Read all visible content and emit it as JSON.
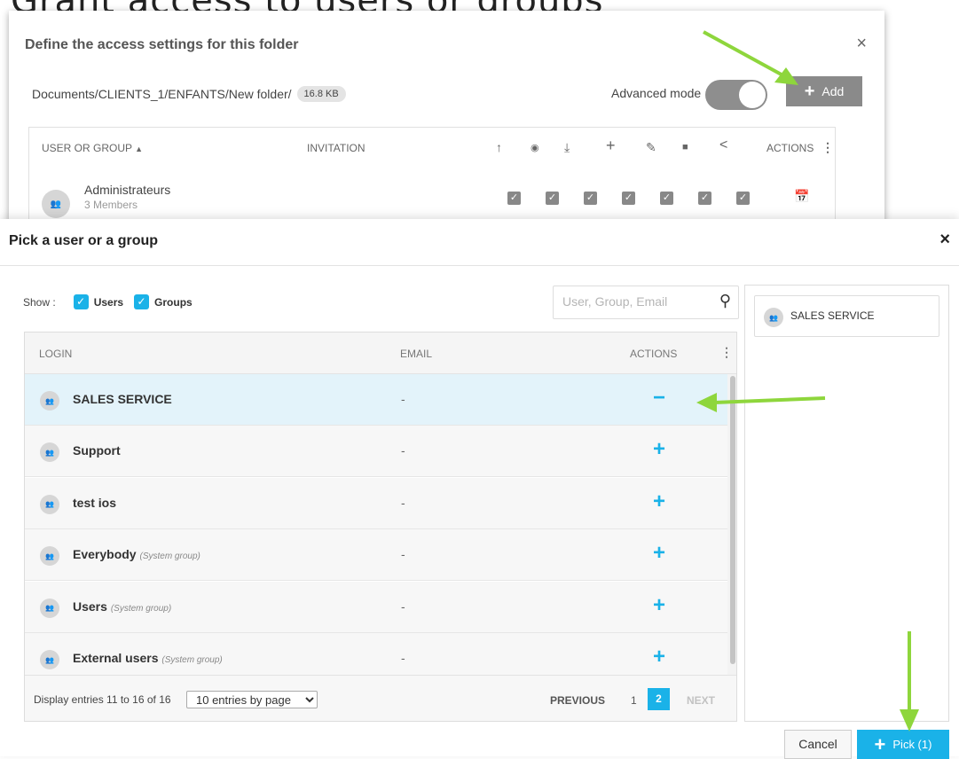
{
  "page_title": "Grant access to users or groups",
  "colors": {
    "accent": "#1ab2e8",
    "arrow": "#8ed63c",
    "selected_row": "#e3f3fa"
  },
  "background_dialog": {
    "title": "Define the access settings for this folder",
    "close_icon": "×",
    "path": "Documents/CLIENTS_1/ENFANTS/New folder/",
    "size": "16.8 KB",
    "advanced_mode_label": "Advanced mode",
    "advanced_mode_on": true,
    "add_label": "Add",
    "columns": {
      "user_or_group": "USER OR GROUP",
      "invitation": "INVITATION",
      "actions": "ACTIONS"
    },
    "permission_icons": [
      "upload-icon",
      "view-icon",
      "download-icon",
      "add-icon",
      "edit-icon",
      "delete-icon",
      "share-icon"
    ],
    "row": {
      "name": "Administrateurs",
      "members": "3 Members",
      "avatar": "group-icon",
      "action_icon": "calendar-icon"
    }
  },
  "picker": {
    "title": "Pick a user or a group",
    "close_icon": "×",
    "show_label": "Show :",
    "filters": [
      {
        "label": "Users",
        "checked": true
      },
      {
        "label": "Groups",
        "checked": true
      }
    ],
    "search_placeholder": "User, Group, Email",
    "table": {
      "columns": {
        "login": "LOGIN",
        "email": "EMAIL",
        "actions": "ACTIONS"
      },
      "rows": [
        {
          "name": "SALES SERVICE",
          "tag": "",
          "email": "-",
          "action": "−",
          "selected": true
        },
        {
          "name": "Support",
          "tag": "",
          "email": "-",
          "action": "+",
          "selected": false
        },
        {
          "name": "test ios",
          "tag": "",
          "email": "-",
          "action": "+",
          "selected": false
        },
        {
          "name": "Everybody",
          "tag": "(System group)",
          "email": "-",
          "action": "+",
          "selected": false
        },
        {
          "name": "Users",
          "tag": "(System group)",
          "email": "-",
          "action": "+",
          "selected": false
        },
        {
          "name": "External users",
          "tag": "(System group)",
          "email": "-",
          "action": "+",
          "selected": false
        }
      ]
    },
    "footer": {
      "entries_text": "Display entries 11 to 16 of 16",
      "page_size": "10 entries by page",
      "previous": "PREVIOUS",
      "pages": [
        "1",
        "2"
      ],
      "current_page": "2",
      "next": "NEXT"
    },
    "selected_items": [
      {
        "name": "SALES SERVICE"
      }
    ],
    "cancel_label": "Cancel",
    "pick_label": "Pick (1)"
  }
}
